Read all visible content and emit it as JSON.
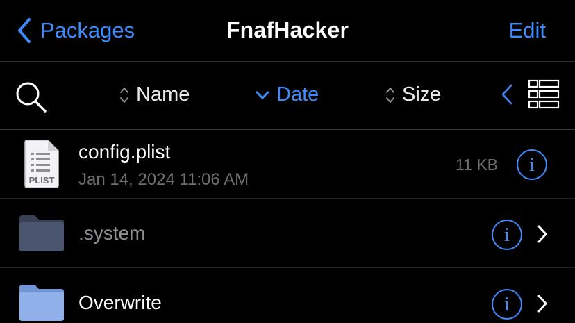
{
  "nav": {
    "back_label": "Packages",
    "title": "FnafHacker",
    "edit_label": "Edit"
  },
  "sort": {
    "name_label": "Name",
    "date_label": "Date",
    "size_label": "Size",
    "active": "Date"
  },
  "files": [
    {
      "name": "config.plist",
      "date": "Jan 14, 2024 11:06 AM",
      "size": "11 KB",
      "type": "plist",
      "badge": "PLIST"
    },
    {
      "name": ".system",
      "type": "folder",
      "hidden": true
    },
    {
      "name": "Overwrite",
      "type": "folder"
    }
  ],
  "icons": {
    "info": "i",
    "back": "chevron-left-icon",
    "search": "search-icon",
    "view": "list-view-icon"
  },
  "colors": {
    "accent": "#3d8bfd",
    "background": "#000000",
    "secondary_text": "#6f6f72"
  }
}
